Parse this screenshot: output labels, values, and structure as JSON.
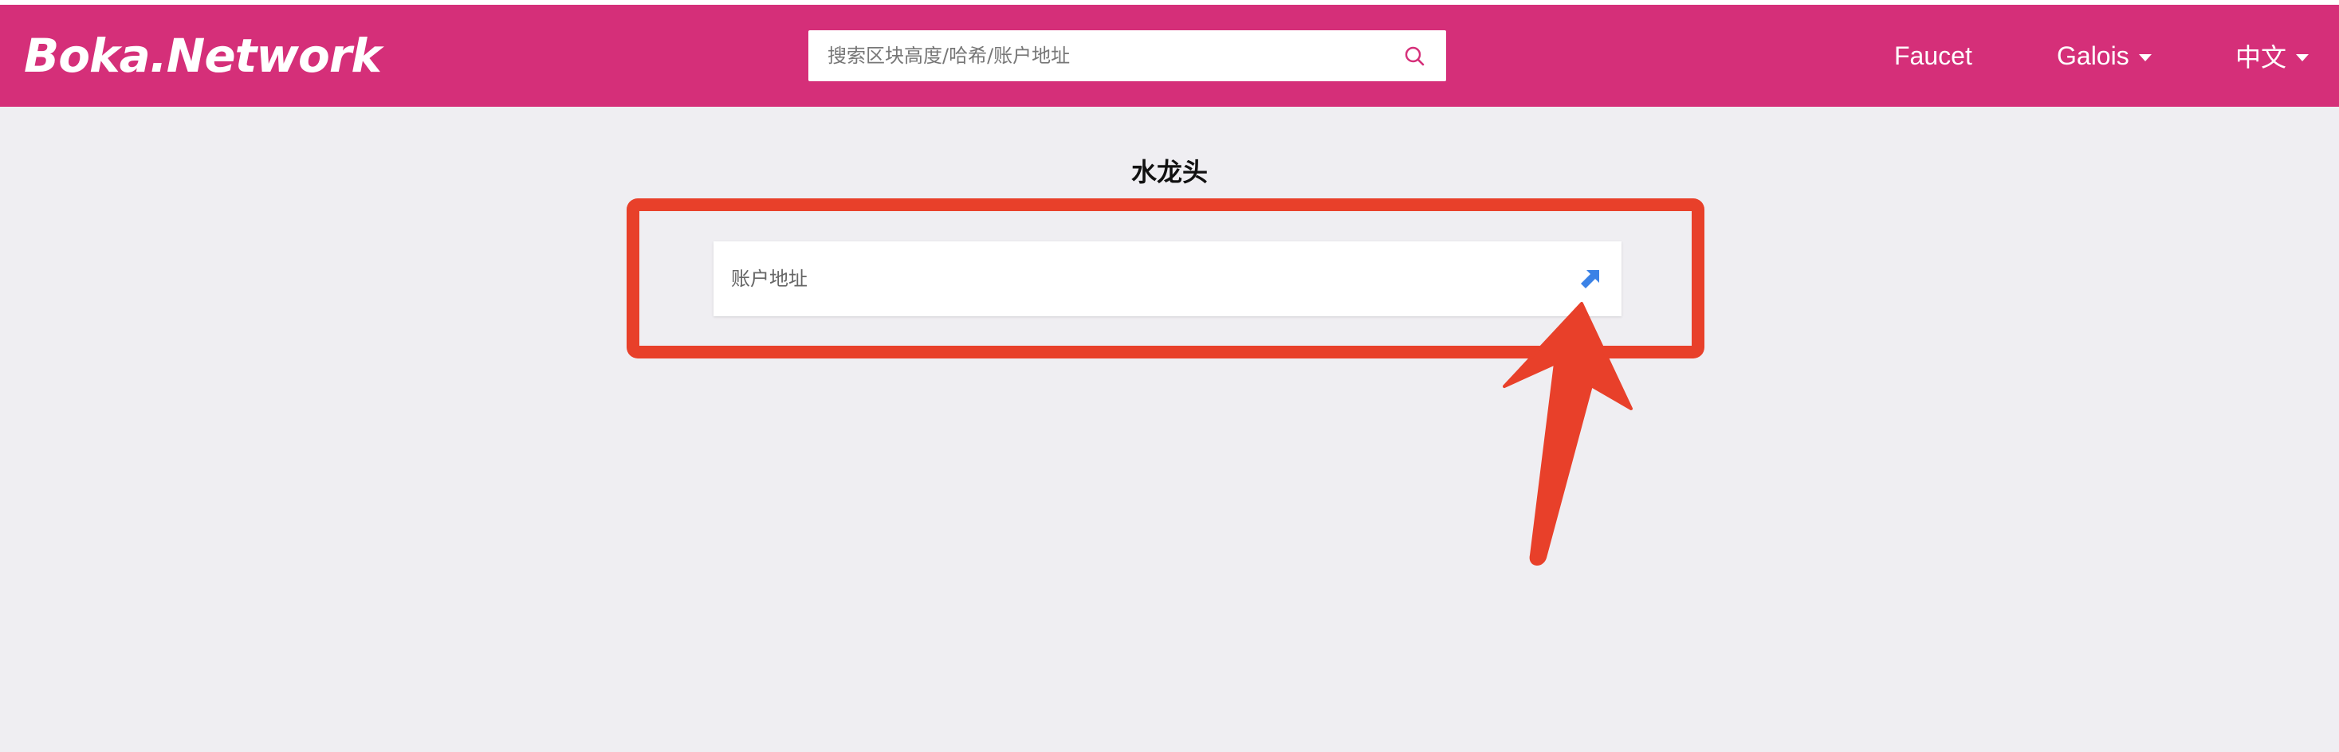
{
  "header": {
    "logo_text": "Boka.Network",
    "search": {
      "placeholder": "搜索区块高度/哈希/账户地址",
      "icon": "search-icon"
    },
    "nav": {
      "faucet_label": "Faucet",
      "network_label": "Galois",
      "language_label": "中文"
    }
  },
  "main": {
    "title": "水龙头",
    "address_input": {
      "placeholder": "账户地址",
      "value": "",
      "submit_icon": "arrow-up-right-icon"
    }
  },
  "colors": {
    "brand": "#d52f79",
    "background": "#efeef2",
    "annotation": "#e8402a",
    "submit_icon": "#3b82e6"
  }
}
